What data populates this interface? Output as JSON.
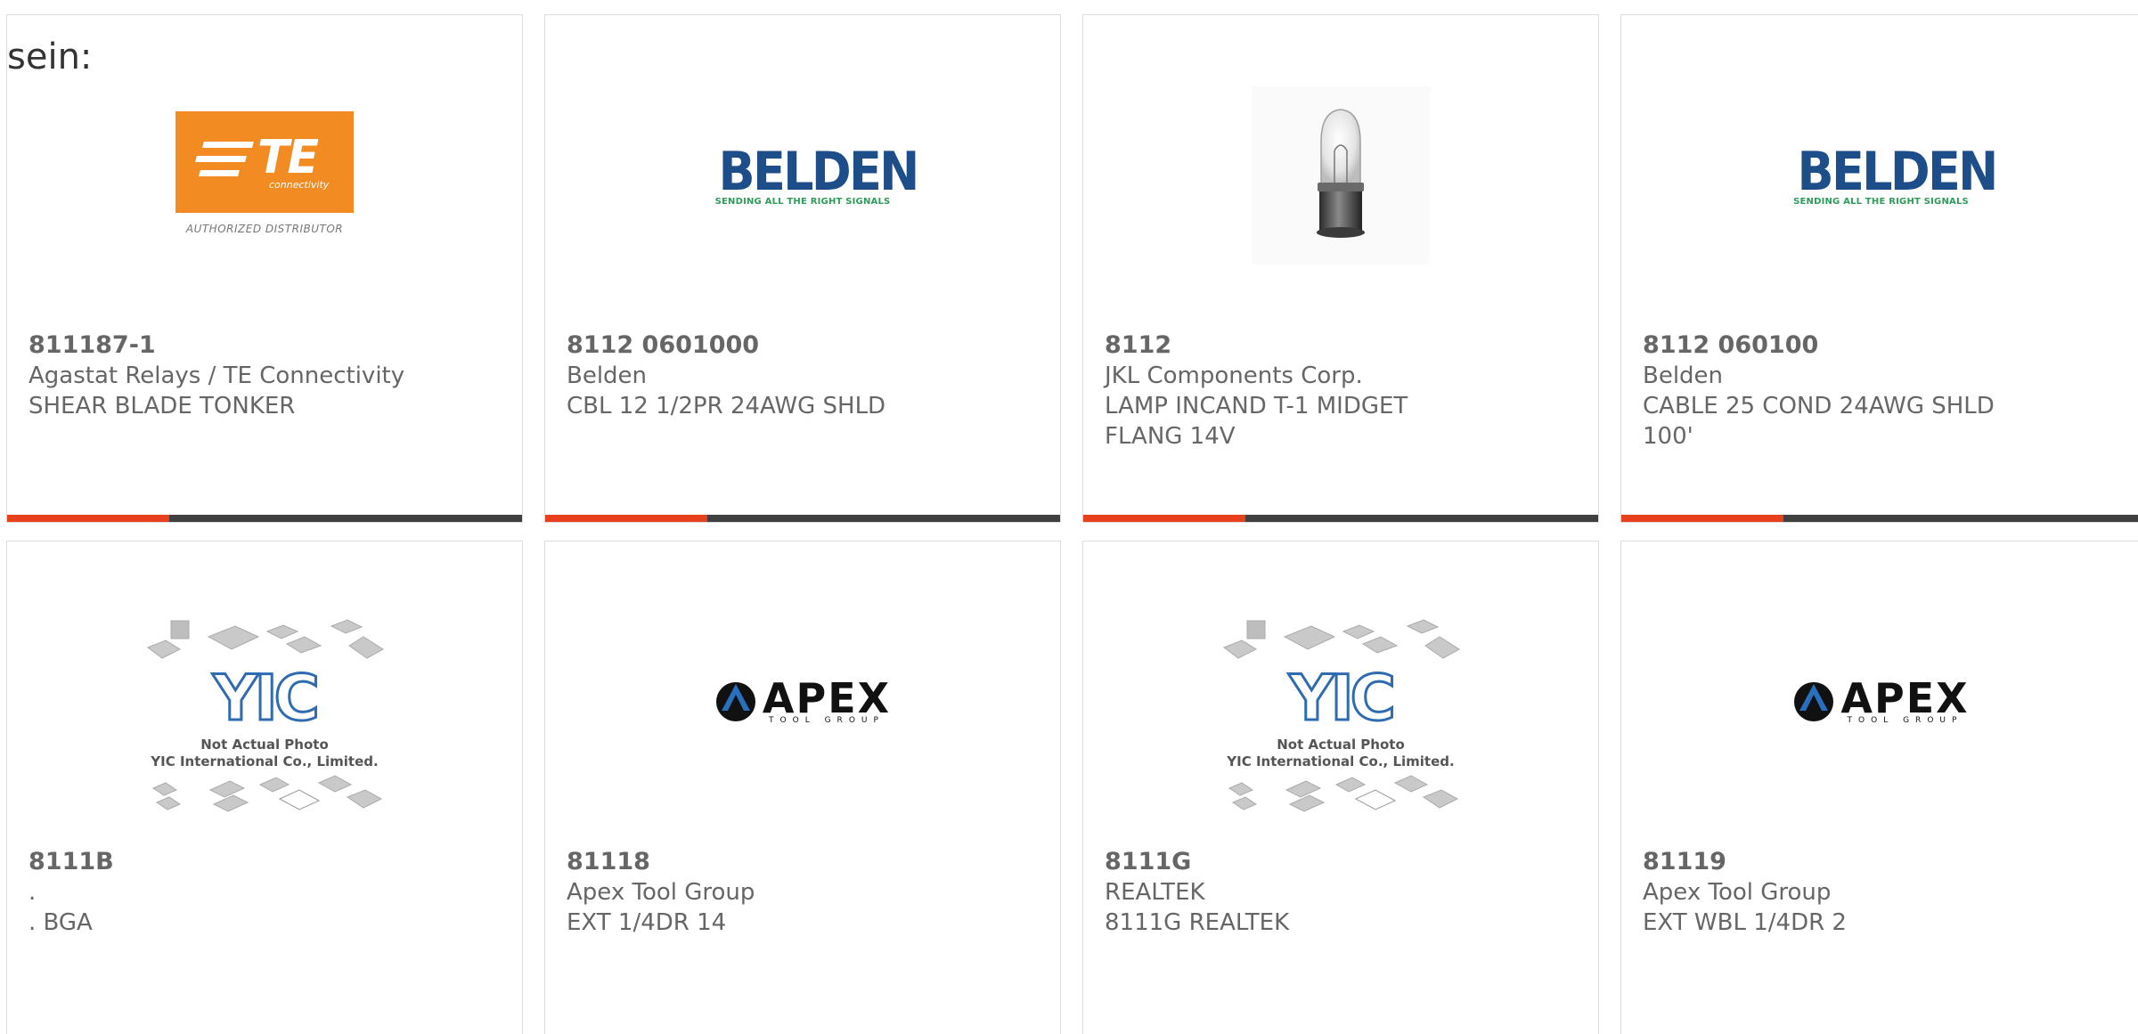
{
  "intro_text": "sein:",
  "colors": {
    "accent_red": "#e8401c",
    "accent_dark": "#404040",
    "text_gray": "#666666"
  },
  "products": [
    {
      "image": "te-connectivity-logo",
      "logo_text": "TE",
      "logo_sub": "connectivity",
      "logo_tag": "AUTHORIZED DISTRIBUTOR",
      "part_number": "811187-1",
      "manufacturer": "Agastat Relays / TE Connectivity",
      "description": "SHEAR BLADE TONKER"
    },
    {
      "image": "belden-logo",
      "logo_text": "BELDEN",
      "logo_tag": "SENDING ALL THE RIGHT SIGNALS",
      "part_number": "8112 0601000",
      "manufacturer": "Belden",
      "description": "CBL 12 1/2PR 24AWG SHLD"
    },
    {
      "image": "incandescent-lamp-photo",
      "part_number": "8112",
      "manufacturer": "JKL Components Corp.",
      "description": "LAMP INCAND T-1 MIDGET FLANG 14V"
    },
    {
      "image": "belden-logo",
      "logo_text": "BELDEN",
      "logo_tag": "SENDING ALL THE RIGHT SIGNALS",
      "part_number": "8112 060100",
      "manufacturer": "Belden",
      "description": "CABLE 25 COND 24AWG SHLD 100'"
    },
    {
      "image": "yic-placeholder",
      "logo_text": "YIC",
      "logo_line1": "Not Actual Photo",
      "logo_line2": "YIC International Co., Limited.",
      "part_number": "8111B",
      "manufacturer": ".",
      "description": ". BGA"
    },
    {
      "image": "apex-tool-group-logo",
      "logo_text": "APEX",
      "logo_sub": "TOOL GROUP",
      "part_number": "81118",
      "manufacturer": "Apex Tool Group",
      "description": "EXT 1/4DR 14"
    },
    {
      "image": "yic-placeholder",
      "logo_text": "YIC",
      "logo_line1": "Not Actual Photo",
      "logo_line2": "YIC International Co., Limited.",
      "part_number": "8111G",
      "manufacturer": "REALTEK",
      "description": "8111G REALTEK"
    },
    {
      "image": "apex-tool-group-logo",
      "logo_text": "APEX",
      "logo_sub": "TOOL GROUP",
      "part_number": "81119",
      "manufacturer": "Apex Tool Group",
      "description": "EXT WBL 1/4DR 2"
    }
  ]
}
